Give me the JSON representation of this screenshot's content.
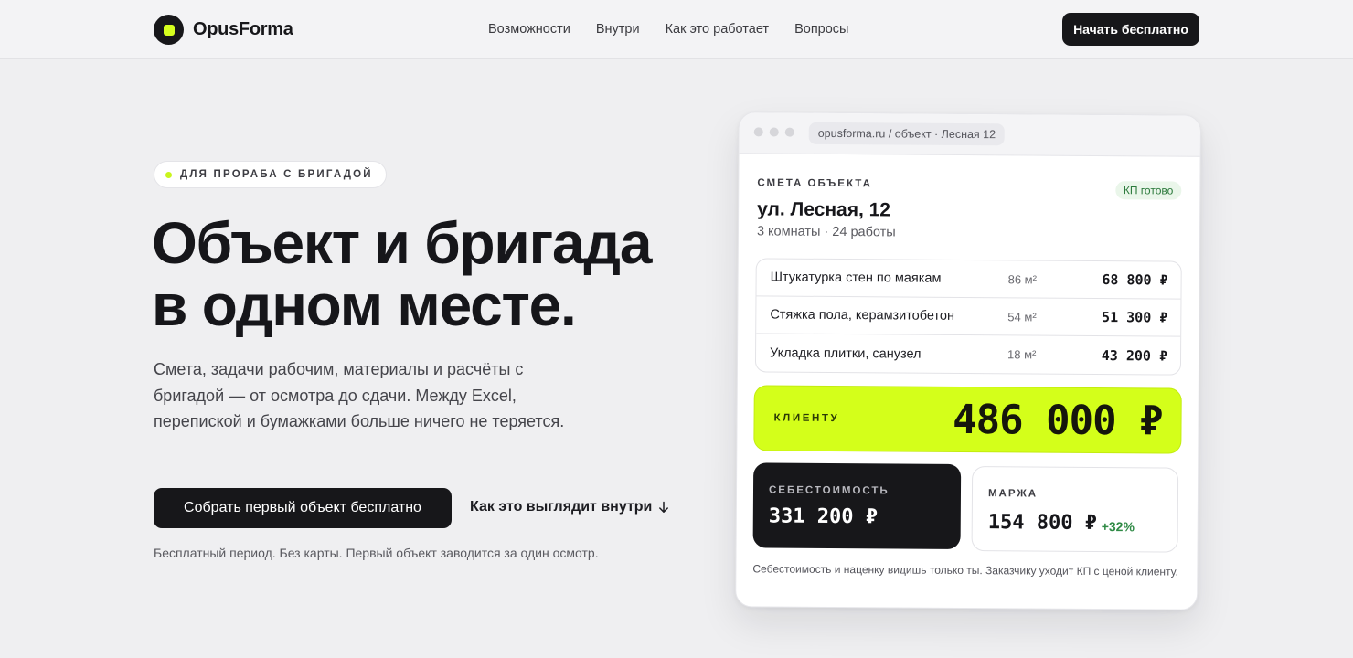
{
  "brand": {
    "name": "OpusForma",
    "accent_color": "#d4ff1a",
    "dark_color": "#17171a"
  },
  "nav": {
    "items": [
      "Возможности",
      "Внутри",
      "Как это работает",
      "Вопросы"
    ],
    "cta_label": "Начать бесплатно"
  },
  "hero": {
    "badge": "ДЛЯ  ПРОРАБА С  БРИГАДОЙ",
    "title": "Объект и  бригада\nв  одном месте.",
    "description": "Смета, задачи рабочим, материалы и  расчёты с  бригадой — от  осмотра до  сдачи. Между Excel, перепиской и  бумажками больше ничего не  теряется.",
    "primary_button": "Собрать первый объект бесплатно",
    "secondary_link": "Как это выглядит внутри",
    "secondary_icon": "arrow-down-icon",
    "note": "Бесплатный период. Без карты. Первый объект заводится за  один осмотр."
  },
  "card": {
    "url": "opusforma.ru / объект · Лесная 12",
    "label": "СМЕТА ОБЪЕКТА",
    "status": "КП готово",
    "address": "ул.  Лесная, 12",
    "meta": "3  комнаты · 24  работы",
    "items": [
      {
        "name": "Штукатурка стен по маякам",
        "qty": "86 м²",
        "sum": "68 800 ₽"
      },
      {
        "name": "Стяжка пола, керамзитобетон",
        "qty": "54 м²",
        "sum": "51 300 ₽"
      },
      {
        "name": "Укладка плитки, санузел",
        "qty": "18 м²",
        "sum": "43 200 ₽"
      }
    ],
    "client_label": "КЛИЕНТУ",
    "client_value": "486 000 ₽",
    "cost_label": "СЕБЕСТОИМОСТЬ",
    "cost_value": "331 200 ₽",
    "margin_label": "МАРЖА",
    "margin_value": "154 800 ₽",
    "margin_pct": "+32%",
    "note": "Себестоимость и  наценку видишь только ты. Заказчику уходит КП с  ценой клиенту."
  }
}
